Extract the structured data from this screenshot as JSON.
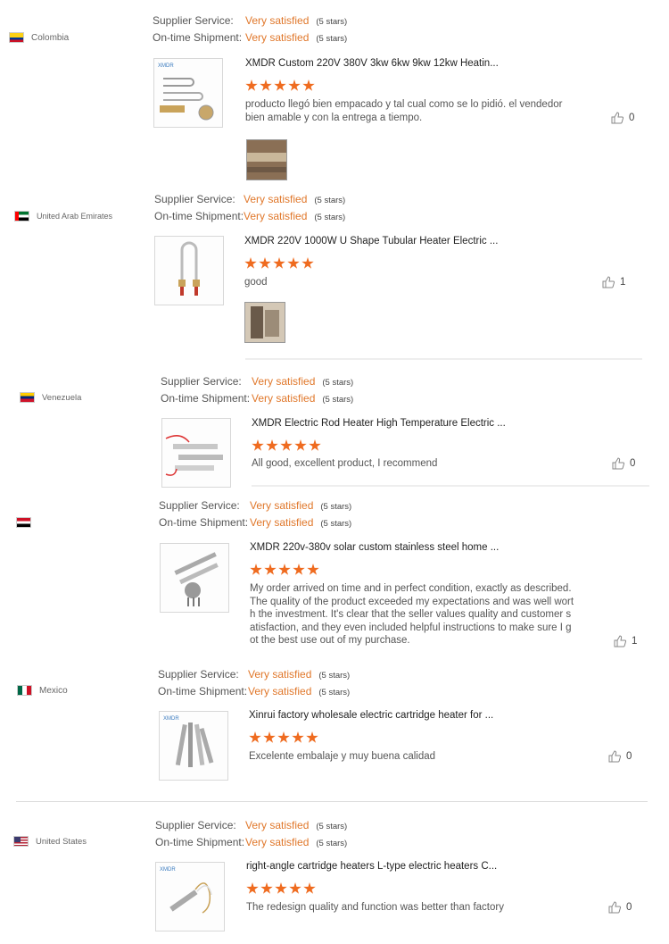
{
  "labels": {
    "supplier_service": "Supplier Service:",
    "ontime_shipment": "On-time Shipment:",
    "very_satisfied": "Very satisfied",
    "five_stars": "(5 stars)"
  },
  "colors": {
    "accent": "#e0772a",
    "star": "#ef6b1f"
  },
  "reviews": [
    {
      "country": "Colombia",
      "product_title": "XMDR Custom 220V 380V 3kw 6kw 9kw 12kw Heatin...",
      "rating": 5,
      "text": "producto llegó bien empacado y tal cual como se lo pidió. el vendedor bien amable y con la entrega a tiempo.",
      "helpful_count": "0",
      "has_photo": true
    },
    {
      "country": "United Arab Emirates",
      "product_title": "XMDR 220V 1000W U Shape Tubular Heater Electric ...",
      "rating": 5,
      "text": "good",
      "helpful_count": "1",
      "has_photo": true
    },
    {
      "country": "Venezuela",
      "product_title": "XMDR Electric Rod Heater High Temperature Electric ...",
      "rating": 5,
      "text": "All good, excellent product, I recommend",
      "helpful_count": "0",
      "has_photo": false
    },
    {
      "country": "",
      "product_title": "XMDR 220v-380v solar custom stainless steel home ...",
      "rating": 5,
      "text": "My order arrived on time and in perfect condition, exactly as described. The quality of the product exceeded my expectations and was well worth the investment. It's clear that the seller values quality and customer satisfaction, and they even included helpful instructions to make sure I got the best use out of my purchase.",
      "helpful_count": "1",
      "has_photo": false
    },
    {
      "country": "Mexico",
      "product_title": "Xinrui factory wholesale electric cartridge heater for ...",
      "rating": 5,
      "text": "Excelente embalaje y muy buena calidad",
      "helpful_count": "0",
      "has_photo": false
    },
    {
      "country": "United States",
      "product_title": "right-angle cartridge heaters L-type electric heaters C...",
      "rating": 5,
      "text": "The redesign quality and function was better than factory",
      "helpful_count": "0",
      "has_photo": false
    }
  ]
}
